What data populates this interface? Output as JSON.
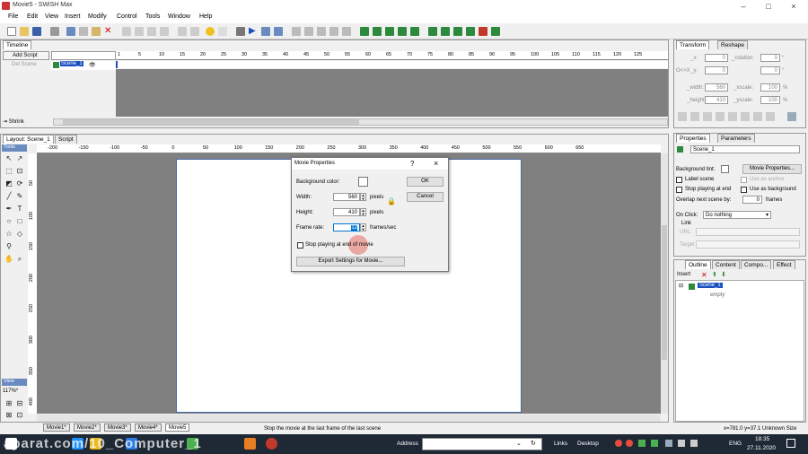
{
  "app": {
    "title": "Movie5 - SWiSH Max"
  },
  "menu": [
    "File",
    "Edit",
    "View",
    "Insert",
    "Modify",
    "Control",
    "Tools",
    "Window",
    "Help"
  ],
  "timeline": {
    "tab": "Timeline",
    "add_script": "Add Script",
    "del_scene": "Del Scene",
    "scene": "Scene_1",
    "shrink": "Shrink",
    "ticks": [
      "1",
      "5",
      "10",
      "15",
      "20",
      "25",
      "30",
      "35",
      "40",
      "45",
      "50",
      "55",
      "60",
      "65",
      "70",
      "75",
      "80",
      "85",
      "90",
      "95",
      "100",
      "105",
      "110",
      "115",
      "120",
      "125"
    ]
  },
  "layout": {
    "tab": "Layout: Scene_1",
    "script_tab": "Script",
    "tools_label": "Tools",
    "view_label": "View",
    "zoom": "117%*",
    "hticks": [
      "-200",
      "-150",
      "-100",
      "-50",
      "0",
      "50",
      "100",
      "150",
      "200",
      "250",
      "300",
      "350",
      "400",
      "450",
      "500",
      "550",
      "600",
      "650"
    ],
    "vticks": [
      "50",
      "100",
      "150",
      "200",
      "250",
      "300",
      "350",
      "400"
    ]
  },
  "dialog": {
    "title": "Movie Properties",
    "help": "?",
    "close": "×",
    "bg_label": "Background color:",
    "width_label": "Width:",
    "width": "560",
    "height_label": "Height:",
    "height": "410",
    "pixels": "pixels",
    "framerate_label": "Frame rate:",
    "framerate": "12",
    "fps": "frames/sec",
    "stop_label": "Stop playing at end of movie",
    "export": "Export Settings for Movie...",
    "ok": "OK",
    "cancel": "Cancel"
  },
  "transform": {
    "tab": "Transform",
    "tab2": "Reshape",
    "x_label": "_x:",
    "x": "0",
    "y_label": "_y:",
    "y": "0",
    "rot_label": "_rotation:",
    "rot": "0",
    "deg": "°",
    "xs_label": "_width:",
    "width": "560",
    "height_label": "_height:",
    "height": "410",
    "xscale_label": "_xscale:",
    "xscale": "100",
    "yscale_label": "_yscale:",
    "yscale": "100",
    "pct": "%",
    "ox_label": "O<>X",
    "oy_label": "O^v"
  },
  "properties": {
    "tab": "Properties",
    "tab2": "Parameters",
    "name": "Scene_1",
    "bg_tint": "Background tint:",
    "movie_props": "Movie Properties...",
    "label_scene": "Label scene",
    "use_anchor": "Use as anchor",
    "stop_end": "Stop playing at end",
    "use_bg": "Use as background",
    "overlap": "Overlap next scene by:",
    "overlap_val": "0",
    "frames": "frames",
    "onclick": "On Click:",
    "onclick_val": "Do nothing",
    "link": "Link",
    "url": "URL:",
    "target": "Target"
  },
  "outline": {
    "tabs": [
      "Outline",
      "Content",
      "Compo...",
      "Effect"
    ],
    "insert": "Insert",
    "scene": "Scene_1",
    "empty": "empty"
  },
  "movie_tabs": [
    "Movie1*",
    "Movie2*",
    "Movie3*",
    "Movie4*",
    "Movie5"
  ],
  "status": {
    "text": "Stop the movie at the last frame of the last scene",
    "coords": "x=781.0 y=37.1 Unknown Size"
  },
  "watermark": "aparat.com/10_Computer_1",
  "taskbar": {
    "address_label": "Address",
    "links": "Links",
    "desktop": "Desktop",
    "lang": "ENG",
    "time": "18:35",
    "date": "27.11.2020"
  }
}
